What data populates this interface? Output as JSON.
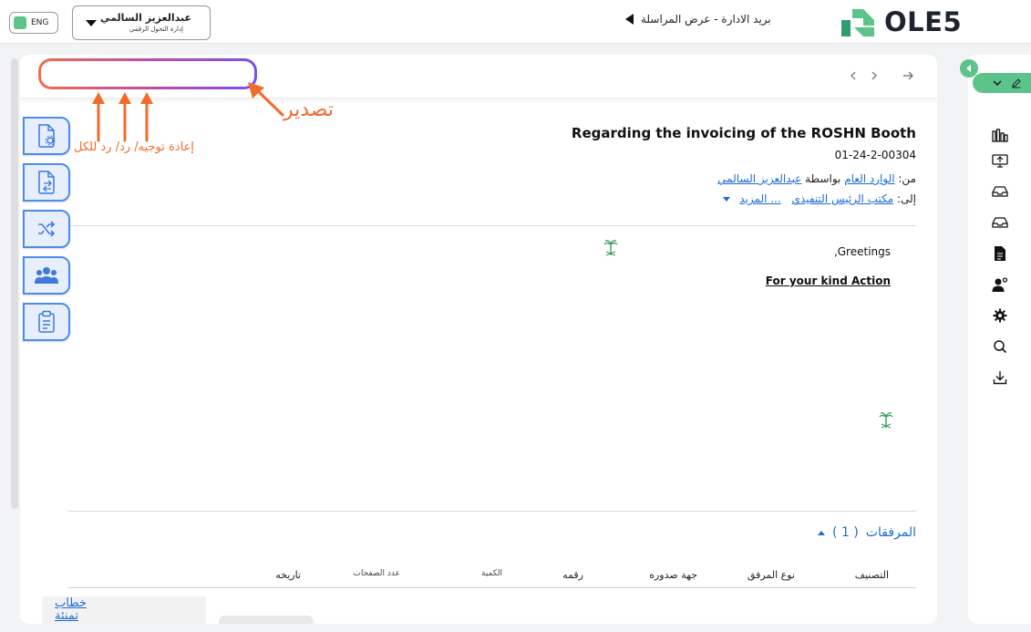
{
  "header": {
    "lang_label": "ENG",
    "user_name": "عبدالعزيز السالمي",
    "user_dept": "إدارة التحول الرقمي",
    "breadcrumb": "بريد الادارة - عرض المراسلة",
    "logo_text": "OLE5",
    "accent_color": "#5cc38a"
  },
  "toolbar": {
    "icons": [
      "close-icon",
      "reply-all-icon",
      "reply-icon",
      "forward-icon",
      "star-icon",
      "flag-icon",
      "more-vertical-icon"
    ],
    "nav_icons": [
      "chevron-left-icon",
      "chevron-right-icon",
      "arrow-right-icon"
    ]
  },
  "message": {
    "subject": "Regarding the invoicing of the ROSHN Booth",
    "ref_no": "01-24-2-00304",
    "from_label": "من:",
    "from_value": "الوارد العام",
    "via_label": "بواسطة",
    "via_value": "عبدالعزيز السالمي",
    "to_label": "إلى:",
    "to_value": "مكتب الرئيس التنفيذي",
    "more_label": "... المزيد",
    "greeting": ",Greetings",
    "action": "For your kind Action"
  },
  "attachments": {
    "title": "المرفقات",
    "count_label": "( 1 )",
    "columns": [
      "التصنيف",
      "نوع المرفق",
      "جهة صدوره",
      "رقمه",
      "الكمية",
      "عدد الصفحات",
      "تاريخه"
    ],
    "first_item_name": "خطاب تمنئة"
  },
  "side_actions": [
    "document-settings-icon",
    "document-transfer-icon",
    "shuffle-icon",
    "users-group-icon",
    "clipboard-icon"
  ],
  "rail": {
    "icons": [
      "chart-bars-icon",
      "monitor-sync-icon",
      "inbox-icon",
      "inbox-outline-icon",
      "document-icon",
      "user-settings-icon",
      "gear-icon",
      "search-icon",
      "download-icon"
    ]
  },
  "annotations": {
    "export": "تصدير",
    "reply_actions": "إعادة توجيه/ رد/ رد للكل"
  }
}
